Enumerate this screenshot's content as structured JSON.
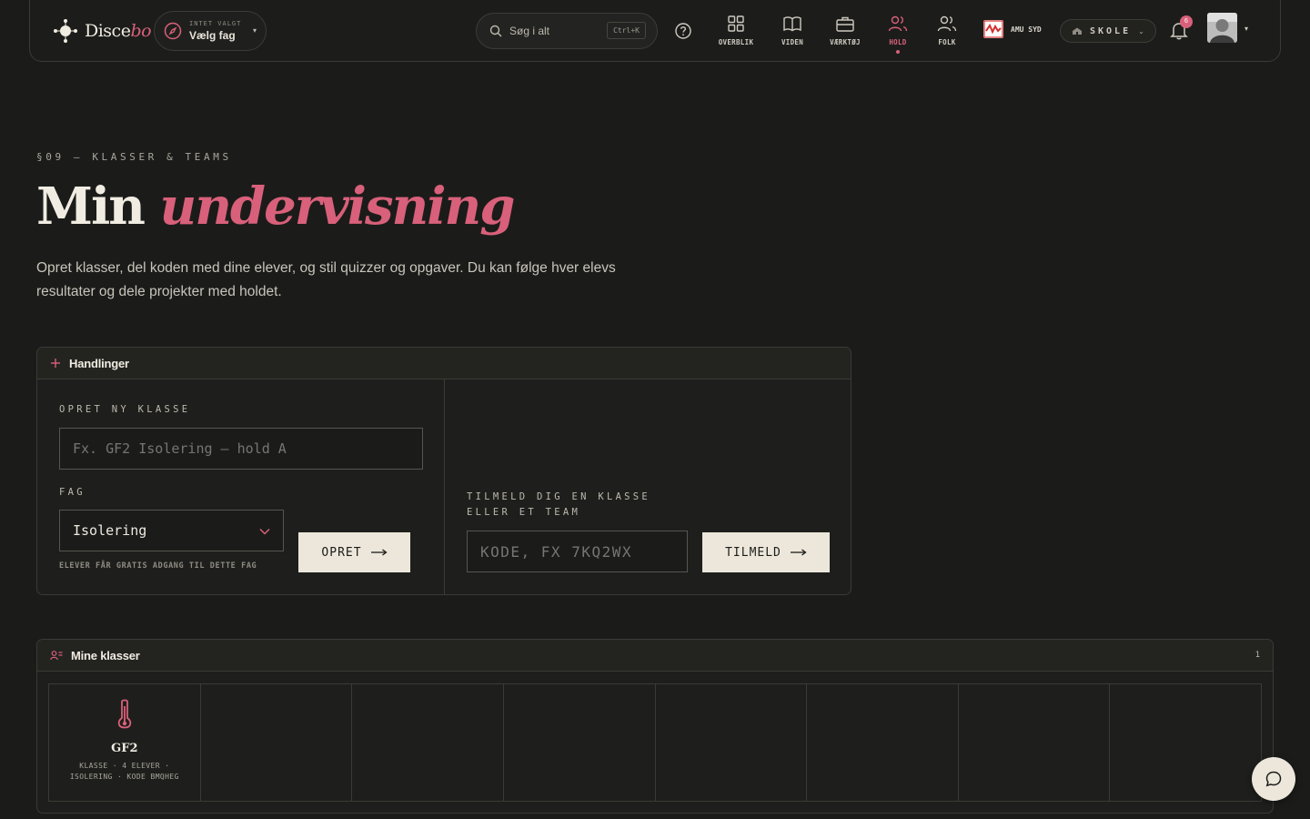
{
  "brand": {
    "name_plain": "Disce",
    "name_italic": "bo"
  },
  "subject_selector": {
    "caption": "INTET VALGT",
    "value": "Vælg fag"
  },
  "search": {
    "placeholder": "Søg i alt",
    "shortcut": "Ctrl+K"
  },
  "nav": {
    "items": [
      {
        "label": "OVERBLIK",
        "icon": "grid-icon"
      },
      {
        "label": "VIDEN",
        "icon": "book-icon"
      },
      {
        "label": "VÆRKTØJ",
        "icon": "toolbox-icon"
      },
      {
        "label": "HOLD",
        "icon": "users-icon",
        "active": true
      },
      {
        "label": "FOLK",
        "icon": "people-icon"
      }
    ]
  },
  "school": {
    "name": "AMU SYD",
    "scope": "SKOLE"
  },
  "notifications": {
    "count": "6"
  },
  "page": {
    "eyebrow": "§09 — KLASSER & TEAMS",
    "title_plain": "Min",
    "title_italic": "undervisning",
    "lead": "Opret klasser, del koden med dine elever, og stil quizzer og opgaver. Du kan følge hver elevs resultater og dele projekter med holdet."
  },
  "actions": {
    "heading": "Handlinger",
    "create": {
      "label": "OPRET NY KLASSE",
      "name_placeholder": "Fx. GF2 Isolering — hold A",
      "subject_label": "FAG",
      "subject_value": "Isolering",
      "hint": "ELEVER FÅR GRATIS ADGANG TIL DETTE FAG",
      "button": "OPRET"
    },
    "join": {
      "label_line1": "TILMELD DIG EN KLASSE",
      "label_line2": "ELLER ET TEAM",
      "code_placeholder": "KODE, FX 7KQ2WX",
      "button": "TILMELD"
    }
  },
  "classes": {
    "heading": "Mine klasser",
    "count": "1",
    "items": [
      {
        "name": "GF2",
        "meta_line1": "KLASSE · 4 ELEVER ·",
        "meta_line2": "ISOLERING · KODE BMQHEG",
        "icon": "thermometer-icon"
      }
    ]
  },
  "colors": {
    "accent": "#d9607a",
    "background": "#1b1c1a",
    "button": "#ede7db"
  }
}
